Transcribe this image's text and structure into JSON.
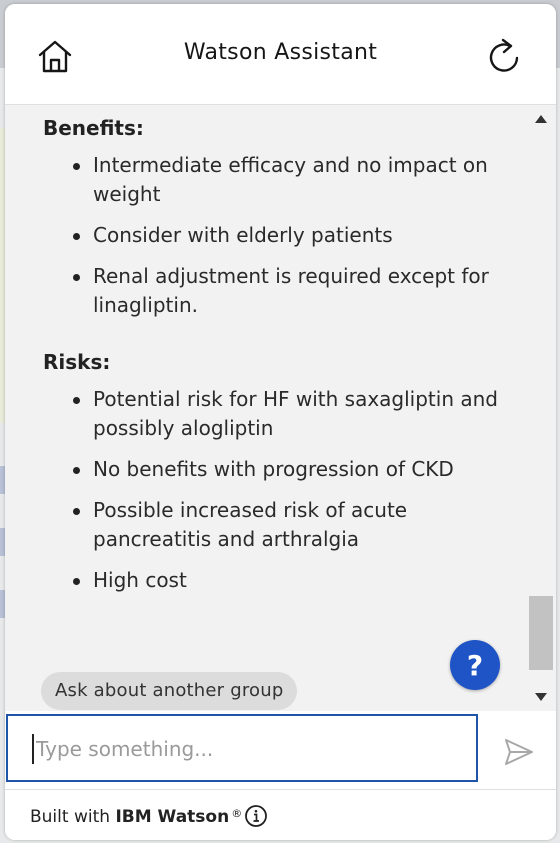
{
  "header": {
    "title": "Watson Assistant",
    "home_icon": "home-icon",
    "refresh_icon": "refresh-icon"
  },
  "message": {
    "benefits": {
      "title": "Benefits:",
      "items": [
        "Intermediate efficacy and no impact on weight",
        "Consider with elderly patients",
        "Renal adjustment is required except for linagliptin."
      ]
    },
    "risks": {
      "title": "Risks:",
      "items": [
        "Potential risk for HF with saxagliptin and possibly alogliptin",
        "No benefits with progression of CKD",
        "Possible increased risk of acute pancreatitis and arthralgia",
        "High cost"
      ]
    }
  },
  "quick_reply": {
    "label": "Ask about another group"
  },
  "help_button": {
    "label": "?"
  },
  "input": {
    "placeholder": "Type something...",
    "value": ""
  },
  "footer": {
    "prefix": "Built with ",
    "brand": "IBM Watson",
    "registered": "®",
    "info_icon": "info-icon"
  },
  "colors": {
    "accent": "#1f54c6",
    "input_border": "#1f54a8",
    "message_bg": "#f2f2f2",
    "chip_bg": "#dcdcdc"
  }
}
